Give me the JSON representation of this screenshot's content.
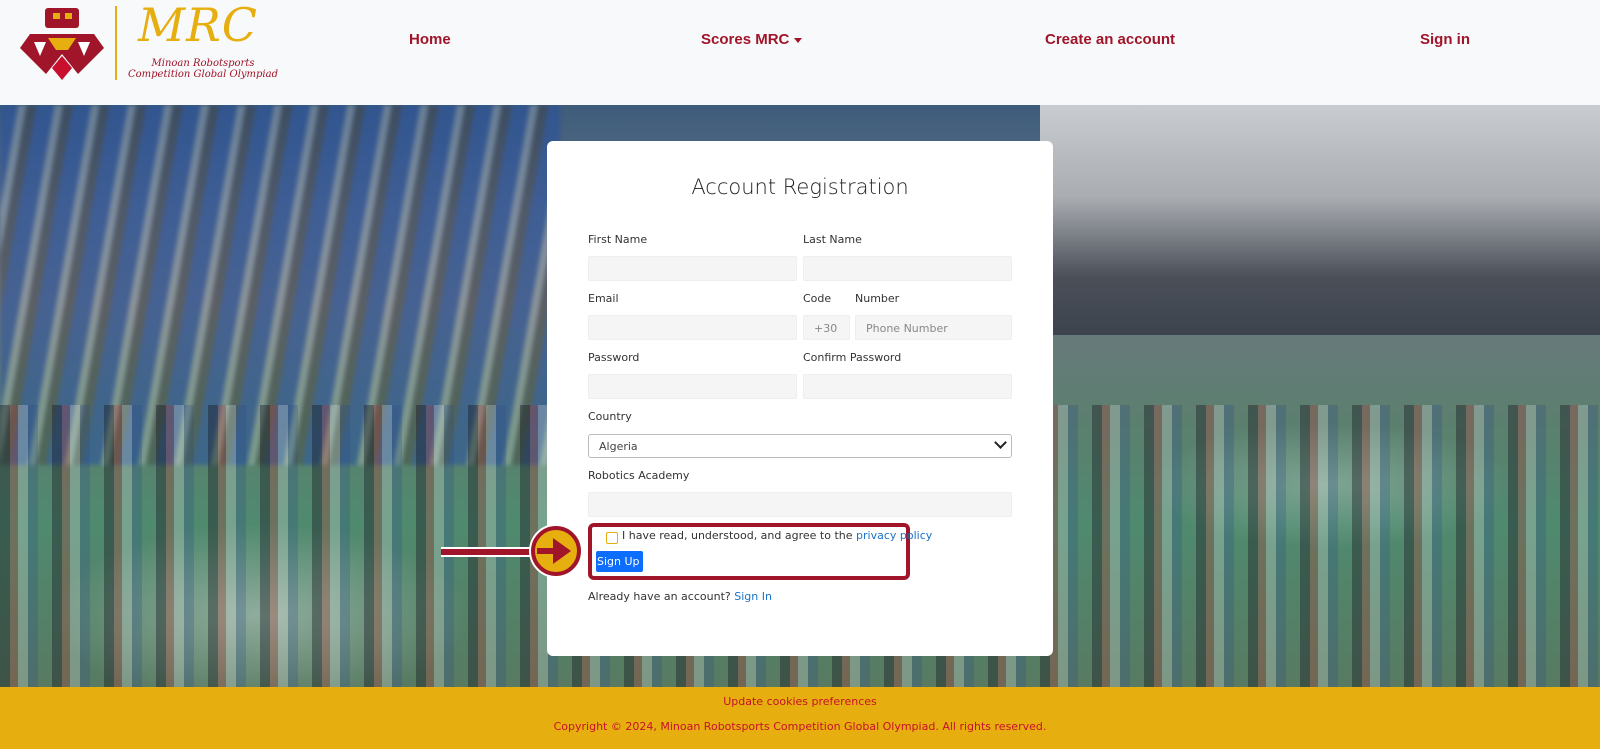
{
  "header": {
    "logo": {
      "title": "MRC",
      "subtitle": "Minoan Robotsports Competition Global Olympiad"
    },
    "nav": {
      "home": "Home",
      "scores": "Scores MRC",
      "create_account": "Create an account",
      "sign_in": "Sign in"
    }
  },
  "form": {
    "title": "Account Registration",
    "first_name": {
      "label": "First Name",
      "value": ""
    },
    "last_name": {
      "label": "Last Name",
      "value": ""
    },
    "email": {
      "label": "Email",
      "value": ""
    },
    "code": {
      "label": "Code",
      "value": "+30"
    },
    "number": {
      "label": "Number",
      "placeholder": "Phone Number"
    },
    "password": {
      "label": "Password",
      "value": ""
    },
    "confirm_password": {
      "label": "Confirm Password",
      "value": ""
    },
    "country": {
      "label": "Country",
      "selected": "Algeria"
    },
    "academy": {
      "label": "Robotics Academy",
      "value": ""
    },
    "agree_text": "I have read, understood, and agree to the",
    "privacy_link": "privacy policy",
    "signup_button": "Sign Up",
    "already_text": "Already have an account?",
    "signin_link": "Sign In"
  },
  "footer": {
    "cookies": "Update cookies preferences",
    "copyright": "Copyright © 2024, Minoan Robotsports Competition Global Olympiad. All rights reserved."
  },
  "colors": {
    "brand_red": "#a0152a",
    "brand_gold": "#e6ae0e",
    "link_blue": "#1a73c7",
    "button_blue": "#0d6efd"
  },
  "icons": [
    "logo-robot-icon",
    "chevron-down-icon",
    "caret-down-icon",
    "arrow-pointer-icon"
  ]
}
